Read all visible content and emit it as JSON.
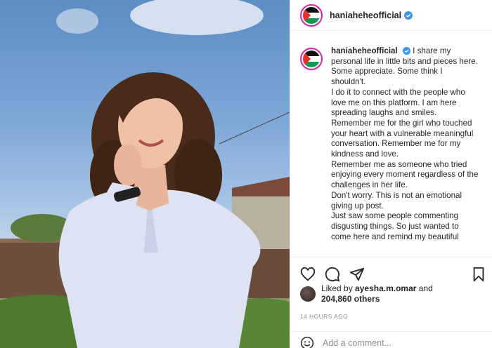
{
  "post": {
    "username": "haniaheheofficial",
    "caption_lines": [
      "I share my personal life in little bits and pieces here. Some appreciate. Some think I shouldn't.",
      "I do it to connect with the people who love me on this platform. I am here spreading laughs and smiles.",
      "Remember me for the girl who touched your heart with a vulnerable meaningful conversation. Remember me for my kindness and love.",
      "Remember me as someone who tried enjoying every moment regardless of the challenges in her life.",
      "Don't worry. This is not an emotional giving up post.",
      "Just saw some people commenting disgusting things. So just wanted to come here and remind my beautiful"
    ],
    "likes": {
      "prefix": "Liked by",
      "user": "ayesha.m.omar",
      "and": "and",
      "count": "204,860 others"
    },
    "timestamp": "14 HOURS AGO",
    "comment_placeholder": "Add a comment..."
  },
  "icons": {
    "verified": "verified-badge-icon",
    "like": "heart-icon",
    "comment": "comment-bubble-icon",
    "share": "paper-plane-icon",
    "save": "bookmark-icon",
    "emoji": "smiley-icon"
  },
  "colors": {
    "verified": "#3897f0",
    "text": "#262626",
    "muted": "#8e8e8e",
    "avatar_ring": "#d6249f"
  }
}
